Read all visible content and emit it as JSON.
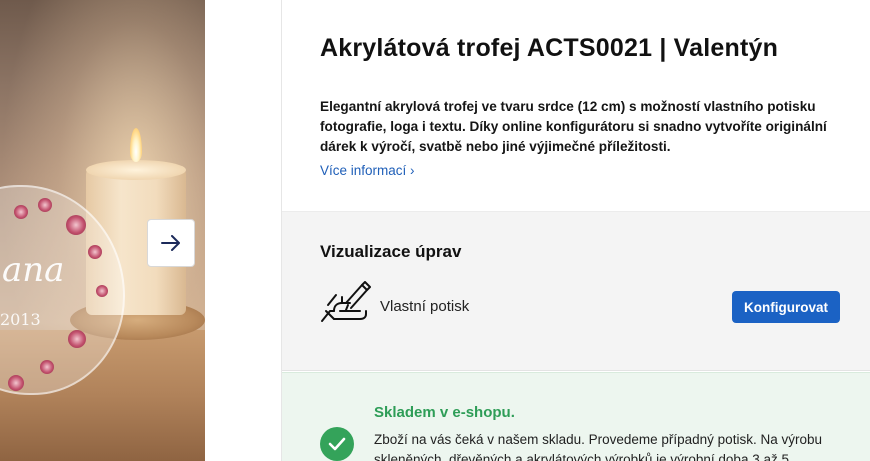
{
  "product": {
    "title": "Akrylátová trofej ACTS0021 | Valentýn",
    "description": "Elegantní akrylová trofej ve tvaru srdce (12 cm) s možností vlastního potisku fotografie, loga i textu. Díky online konfigurátoru si snadno vytvoříte originální dárek k výročí, svatbě nebo jiné výjimečné příležitosti.",
    "more_link": "Více informací ›"
  },
  "gallery": {
    "image_text_script": "ana",
    "image_text_year": "2013",
    "next_icon": "arrow-right-icon"
  },
  "visualization": {
    "title": "Vizualizace úprav",
    "option_label": "Vlastní potisk",
    "option_icon": "hand-writing-icon",
    "configure_button": "Konfigurovat"
  },
  "stock": {
    "title": "Skladem v e-shopu.",
    "text": "Zboží na vás čeká v našem skladu. Provedeme případný potisk. Na výrobu skleněných, dřevěných a akrylátových výrobků je výrobní doba 3 až 5",
    "icon": "check-circle-icon"
  },
  "colors": {
    "accent": "#1b62c4",
    "link": "#1f5fb8",
    "stock_green": "#2e9d57",
    "stock_bg": "#edf6ef",
    "viz_bg": "#f4f4f4"
  }
}
